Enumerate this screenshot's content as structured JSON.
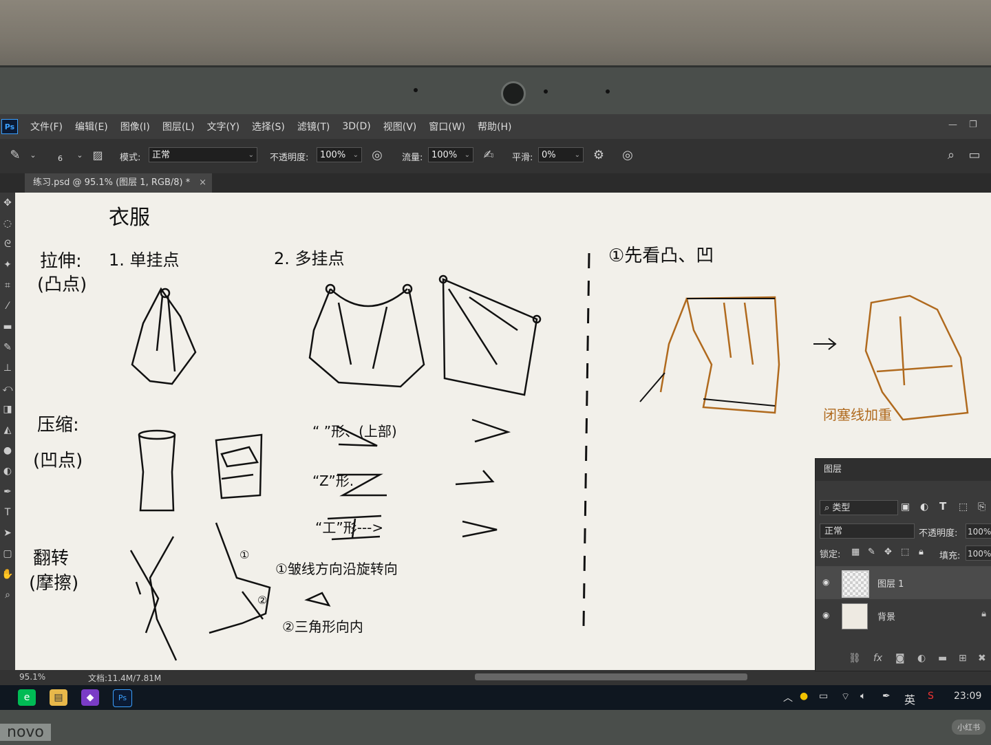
{
  "menu": {
    "logo": "Ps",
    "items": [
      "文件(F)",
      "编辑(E)",
      "图像(I)",
      "图层(L)",
      "文字(Y)",
      "选择(S)",
      "滤镜(T)",
      "3D(D)",
      "视图(V)",
      "窗口(W)",
      "帮助(H)"
    ]
  },
  "options": {
    "brush_size": "6",
    "mode_label": "模式:",
    "mode_value": "正常",
    "opacity_label": "不透明度:",
    "opacity_value": "100%",
    "flow_label": "流量:",
    "flow_value": "100%",
    "smooth_label": "平滑:",
    "smooth_value": "0%"
  },
  "document": {
    "tab_title": "练习.psd @ 95.1% (图层 1, RGB/8) *",
    "close": "×"
  },
  "status": {
    "zoom": "95.1%",
    "doc_info": "文档:11.4M/7.81M"
  },
  "layers_panel": {
    "title": "图层",
    "filter_kind": "类型",
    "blend_mode": "正常",
    "opacity_label": "不透明度:",
    "opacity_value": "100%",
    "lock_label": "锁定:",
    "fill_label": "填充:",
    "fill_value": "100%",
    "layers": [
      {
        "name": "图层 1",
        "selected": true
      },
      {
        "name": "背景",
        "selected": false,
        "locked": true
      }
    ]
  },
  "canvas_text": {
    "title": "衣服",
    "stretch": "拉伸:",
    "stretch_sub": "(凸点)",
    "single": "1.  单挂点",
    "multi": "2. 多挂点",
    "compress": "压缩:",
    "compress_sub": "(凹点)",
    "flip": "翻转",
    "flip_sub": "(摩擦)",
    "shape1": "“ ”形、(上部)",
    "shape2": "“Z”形.",
    "shape3": "“工”形--->",
    "note1": "①皱线方向沿旋转向",
    "note2": "②三角形向内",
    "right_title": "①先看凸、凹",
    "closed": "闭塞线加重",
    "circle1": "①",
    "circle2": "②"
  },
  "taskbar": {
    "ime": "英",
    "time": "23:09"
  },
  "bezel": {
    "brand": "novo",
    "watermark": "小红书"
  }
}
